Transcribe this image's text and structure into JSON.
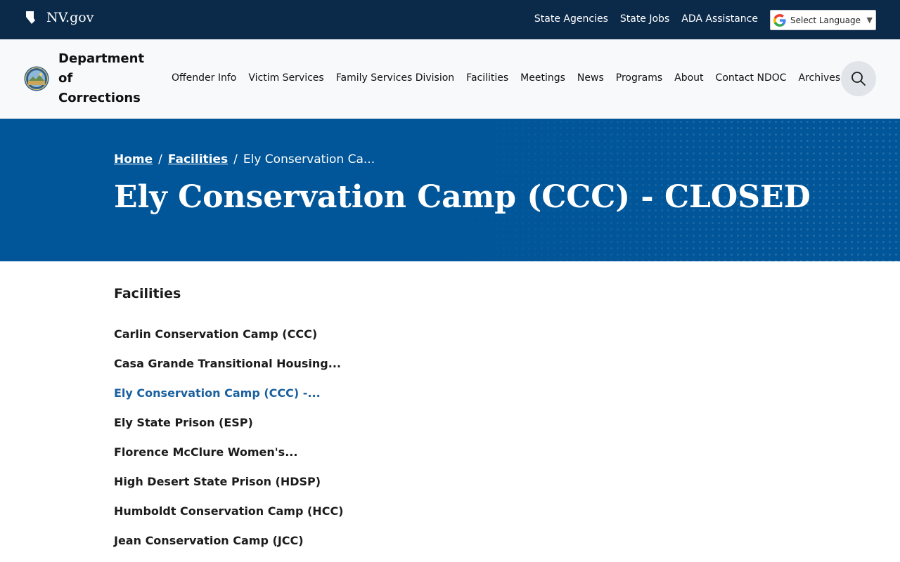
{
  "topbar": {
    "site": "NV.gov",
    "links": [
      "State Agencies",
      "State Jobs",
      "ADA Assistance"
    ],
    "language": "Select Language"
  },
  "header": {
    "agency_lines": [
      "Department",
      "of",
      "Corrections"
    ],
    "nav": [
      "Offender Info",
      "Victim Services",
      "Family Services Division",
      "Facilities",
      "Meetings",
      "News",
      "Programs",
      "About",
      "Contact NDOC",
      "Archives"
    ]
  },
  "hero": {
    "breadcrumb": {
      "home": "Home",
      "facilities": "Facilities",
      "current": "Ely Conservation Ca..."
    },
    "title": "Ely Conservation Camp (CCC) - CLOSED"
  },
  "sidebar": {
    "heading": "Facilities",
    "items": [
      "Carlin Conservation Camp (CCC)",
      "Casa Grande Transitional Housing...",
      "Ely Conservation Camp (CCC) -...",
      "Ely State Prison (ESP)",
      "Florence McClure Women's...",
      "High Desert State Prison (HDSP)",
      "Humboldt Conservation Camp (HCC)",
      "Jean Conservation Camp (JCC)"
    ],
    "active_index": 2
  },
  "colors": {
    "topbar": "#0b2a4a",
    "hero": "#005699",
    "active_link": "#1a5f9e"
  }
}
